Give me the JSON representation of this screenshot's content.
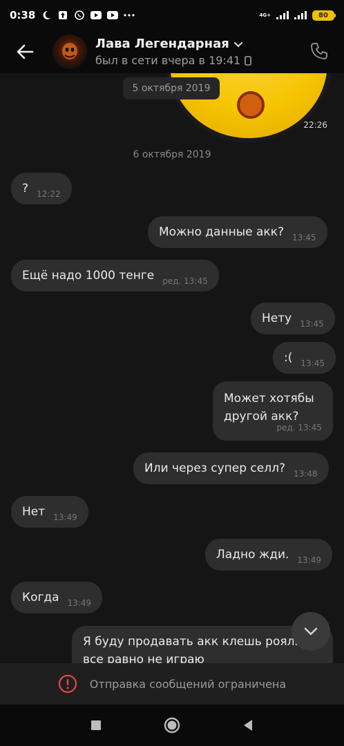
{
  "status_bar": {
    "time": "0:38",
    "network": "4G+",
    "battery": "80"
  },
  "header": {
    "contact_name": "Лава Легендарная",
    "status_text": "был в сети вчера в 19:41"
  },
  "chat": {
    "sticker_time": "22:26",
    "date_chip_1": "5 октября 2019",
    "date_chip_2": "6 октября 2019",
    "messages": [
      {
        "text": "?",
        "time": "12:22"
      },
      {
        "text": "Можно данные акк?",
        "time": "13:45"
      },
      {
        "text": "Ещё надо 1000 тенге",
        "time": "ред. 13:45"
      },
      {
        "text": "Нету",
        "time": "13:45"
      },
      {
        "text": ":(",
        "time": "13:45"
      },
      {
        "text": "Может хотябы другой акк?",
        "time": "ред. 13:45"
      },
      {
        "text": "Или через супер селл?",
        "time": "13:48"
      },
      {
        "text": "Нет",
        "time": "13:49"
      },
      {
        "text": "Ладно жди.",
        "time": "13:49"
      },
      {
        "text": "Когда",
        "time": "13:49"
      },
      {
        "text": "Я буду продавать акк клешь рояль все равно не играю",
        "time": ""
      }
    ]
  },
  "restricted": {
    "text": "Отправка сообщений ограничена"
  },
  "colors": {
    "accent_warning": "#e04a4a",
    "bubble": "#2e2e2e",
    "background": "#151515"
  }
}
